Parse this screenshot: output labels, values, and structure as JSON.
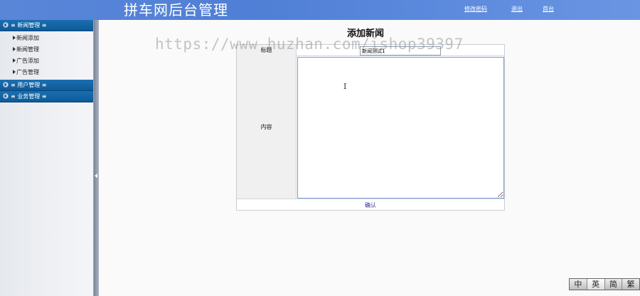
{
  "header": {
    "title": "拼车网后台管理",
    "nav": [
      "修改密码",
      "退出",
      "首台"
    ]
  },
  "sidebar": {
    "groups": [
      {
        "label": "≡ 新闻管理 ≡",
        "items": [
          "新闻添加",
          "新闻管理",
          "广告添加",
          "广告管理"
        ]
      },
      {
        "label": "≡ 用户管理 ≡",
        "items": []
      },
      {
        "label": "≡ 业务管理 ≡",
        "items": []
      }
    ]
  },
  "main": {
    "page_title": "添加新闻",
    "form": {
      "title_label": "标题",
      "title_value": "新闻测试1",
      "content_label": "内容",
      "content_value": "",
      "text_cursor": "I",
      "submit_label": "确认"
    }
  },
  "watermark": "https://www.huzhan.com/ishop39397",
  "lang_bar": [
    "中",
    "英",
    "简",
    "繁"
  ]
}
